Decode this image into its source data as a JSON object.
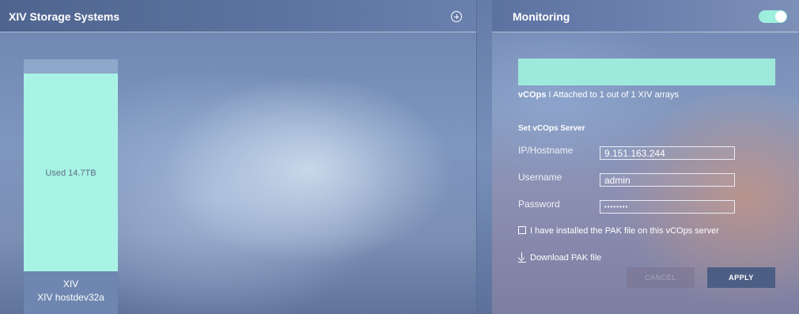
{
  "storage": {
    "title": "XIV Storage Systems",
    "bar": {
      "used_label": "Used 14.7TB",
      "name": "XIV",
      "host": "XIV hostdev32a",
      "fill_color": "#a8f3e5"
    }
  },
  "monitoring": {
    "title": "Monitoring",
    "toggle_on": true,
    "accent_color": "#9eeedd",
    "status_prefix": "vCOps",
    "status_sep": "I",
    "status_text": "Attached to 1 out of 1 XIV arrays",
    "section_title": "Set vCOps Server",
    "fields": {
      "ip_label": "IP/Hostname",
      "ip_value": "9.151.163.244",
      "user_label": "Username",
      "user_value": "admin",
      "pass_label": "Password",
      "pass_value": "••••••••"
    },
    "checkbox_label": "I have installed the PAK file on this vCOps server",
    "download_label": "Download PAK file",
    "cancel_label": "CANCEL",
    "apply_label": "APPLY"
  }
}
